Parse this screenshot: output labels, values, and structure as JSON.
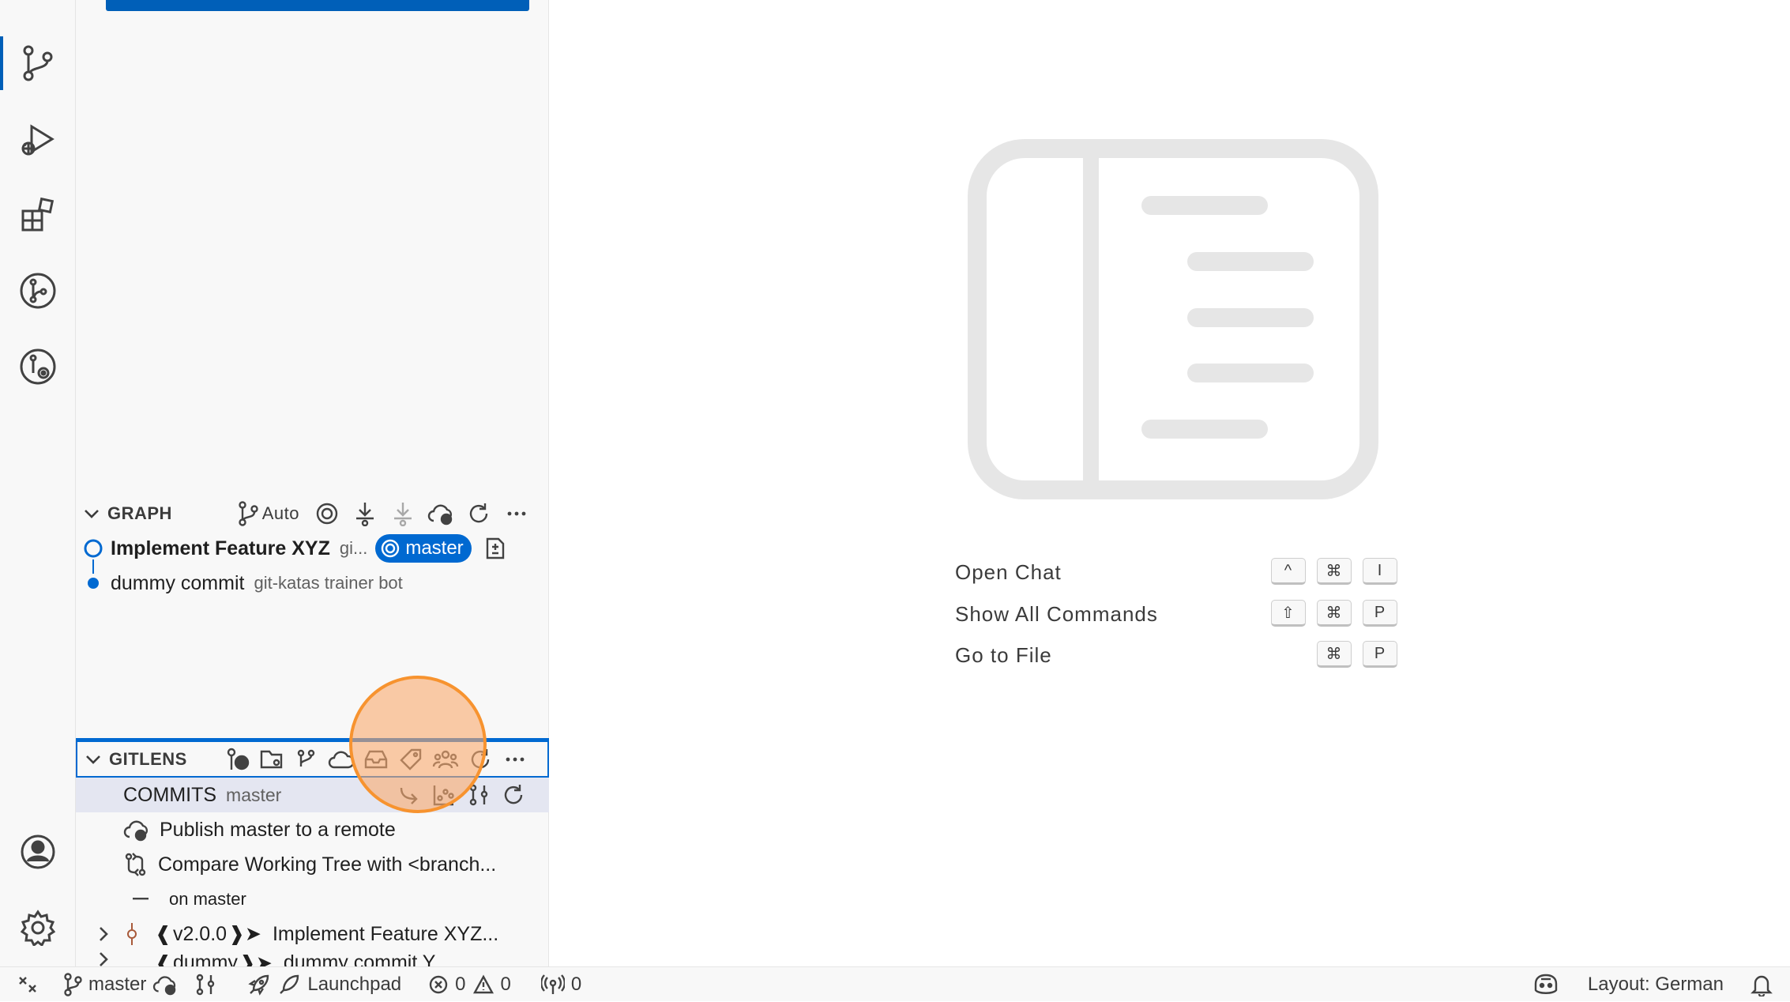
{
  "colors": {
    "accent": "#005fb8",
    "badge": "#0069d1",
    "marker": "#f7932f"
  },
  "activity_bar": {
    "items": [
      {
        "icon": "source-control-icon",
        "active": true
      },
      {
        "icon": "run-debug-icon"
      },
      {
        "icon": "extensions-icon"
      },
      {
        "icon": "gitlens-icon"
      },
      {
        "icon": "gitlens-inspect-icon"
      }
    ],
    "bottom": [
      {
        "icon": "account-icon"
      },
      {
        "icon": "settings-gear-icon"
      }
    ]
  },
  "graph": {
    "title": "GRAPH",
    "auto_label": "Auto",
    "commits": [
      {
        "message": "Implement Feature XYZ",
        "author": "gi...",
        "branch": "master"
      },
      {
        "message": "dummy commit",
        "author": "git-katas trainer bot"
      }
    ]
  },
  "gitlens": {
    "title": "GITLENS",
    "commits_label": "COMMITS",
    "commits_branch": "master",
    "items": [
      {
        "label": "Publish master to a remote"
      },
      {
        "label": "Compare Working Tree with <branch..."
      },
      {
        "label": "on master"
      },
      {
        "tag": "v2.0.0",
        "label": "Implement Feature XYZ..."
      },
      {
        "tag": "dummy",
        "label": "dummy commit Y..."
      }
    ]
  },
  "editor": {
    "shortcuts": [
      {
        "label": "Open Chat",
        "keys": [
          "^",
          "⌘",
          "I"
        ]
      },
      {
        "label": "Show All Commands",
        "keys": [
          "⇧",
          "⌘",
          "P"
        ]
      },
      {
        "label": "Go to File",
        "keys": [
          "⌘",
          "P"
        ]
      }
    ]
  },
  "status_bar": {
    "branch": "master",
    "launchpad": "Launchpad",
    "errors": "0",
    "warnings": "0",
    "ports": "0",
    "layout": "Layout: German"
  }
}
